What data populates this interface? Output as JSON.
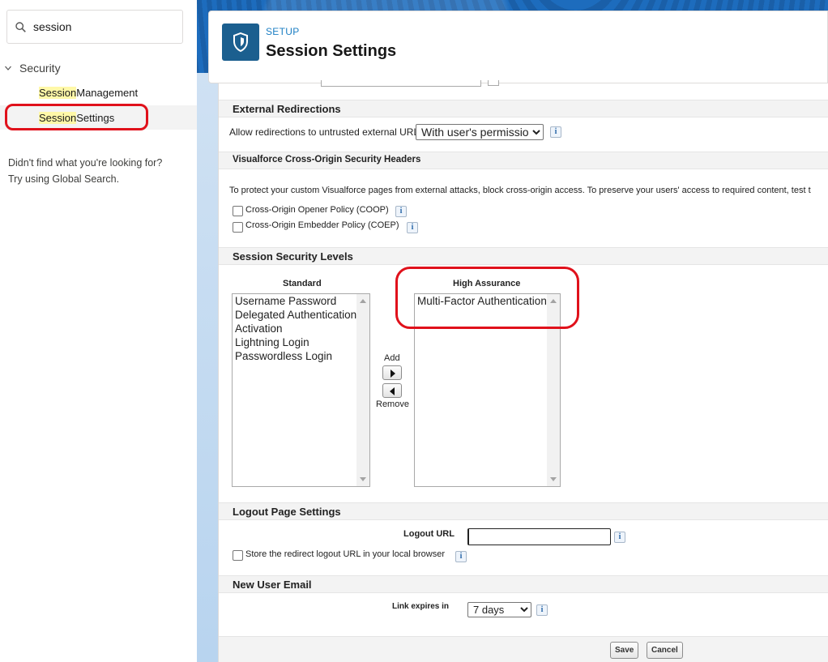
{
  "sidebar": {
    "search": {
      "value": "session"
    },
    "tree": {
      "parent_label": "Security",
      "items": [
        {
          "highlight": "Session",
          "rest": " Management"
        },
        {
          "highlight": "Session",
          "rest": " Settings"
        }
      ]
    },
    "not_found": {
      "line1": "Didn't find what you're looking for?",
      "line2": "Try using Global Search."
    }
  },
  "header": {
    "breadcrumb": "SETUP",
    "title": "Session Settings"
  },
  "external_redirections": {
    "heading": "External Redirections",
    "label": "Allow redirections to untrusted external URLs",
    "selected": "With user's permission",
    "info": "i"
  },
  "visualforce": {
    "heading": "Visualforce Cross-Origin Security Headers",
    "description": "To protect your custom Visualforce pages from external attacks, block cross-origin access. To preserve your users' access to required content, test t",
    "coop_label": "Cross-Origin Opener Policy (COOP)",
    "coep_label": "Cross-Origin Embedder Policy (COEP)"
  },
  "session_levels": {
    "heading": "Session Security Levels",
    "standard_label": "Standard",
    "standard_options": [
      "Username Password",
      "Delegated Authentication",
      "Activation",
      "Lightning Login",
      "Passwordless Login"
    ],
    "high_label": "High Assurance",
    "high_options": [
      "Multi-Factor Authentication"
    ],
    "add_label": "Add",
    "remove_label": "Remove"
  },
  "logout": {
    "heading": "Logout Page Settings",
    "url_label": "Logout URL",
    "url_value": "",
    "store_label": "Store the redirect logout URL in your local browser"
  },
  "new_user_email": {
    "heading": "New User Email",
    "expires_label": "Link expires in",
    "expires_value": "7 days"
  },
  "footer": {
    "save": "Save",
    "cancel": "Cancel"
  },
  "colors": {
    "annotation_red": "#e0111b",
    "highlight_yellow": "#fff8a8",
    "header_icon": "#1b5f8f",
    "setup_blue": "#1b7ec3"
  }
}
